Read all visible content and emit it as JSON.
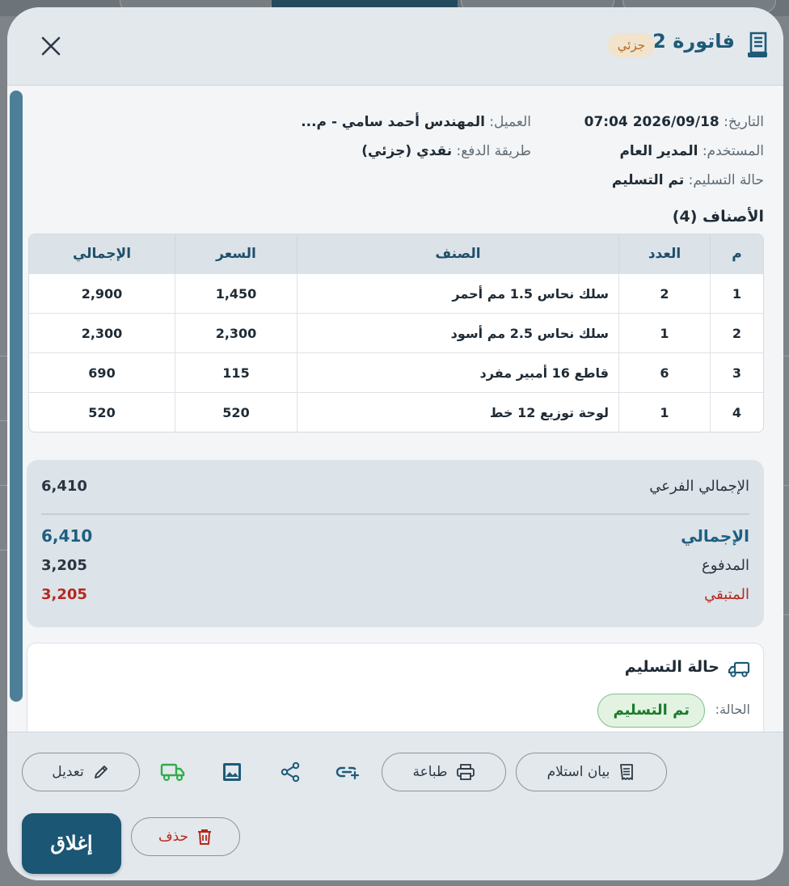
{
  "header": {
    "title": "فاتورة 2",
    "badge": "جزئي"
  },
  "info": {
    "date_label": "التاريخ:",
    "date_value": "2026/09/18 07:04",
    "client_label": "العميل:",
    "client_value": "المهندس أحمد سامي - م...",
    "user_label": "المستخدم:",
    "user_value": "المدير العام",
    "payment_label": "طريقة الدفع:",
    "payment_value": "نقدي (جزئي)",
    "delivery_label": "حالة التسليم:",
    "delivery_value": "تم التسليم"
  },
  "items": {
    "title": "الأصناف (4)",
    "headers": {
      "idx": "م",
      "qty": "العدد",
      "name": "الصنف",
      "price": "السعر",
      "total": "الإجمالي"
    },
    "rows": [
      {
        "idx": "1",
        "qty": "2",
        "name": "سلك نحاس 1.5 مم أحمر",
        "price": "1,450",
        "total": "2,900"
      },
      {
        "idx": "2",
        "qty": "1",
        "name": "سلك نحاس 2.5 مم أسود",
        "price": "2,300",
        "total": "2,300"
      },
      {
        "idx": "3",
        "qty": "6",
        "name": "قاطع 16 أمبير مفرد",
        "price": "115",
        "total": "690"
      },
      {
        "idx": "4",
        "qty": "1",
        "name": "لوحة توزيع 12 خط",
        "price": "520",
        "total": "520"
      }
    ]
  },
  "totals": {
    "subtotal_label": "الإجمالي الفرعي",
    "subtotal_value": "6,410",
    "total_label": "الإجمالي",
    "total_value": "6,410",
    "paid_label": "المدفوع",
    "paid_value": "3,205",
    "remaining_label": "المتبقي",
    "remaining_value": "3,205"
  },
  "delivery": {
    "title": "حالة التسليم",
    "status_label": "الحالة:",
    "status_value": "تم التسليم"
  },
  "footer": {
    "receipt_label": "بيان استلام",
    "print_label": "طباعة",
    "edit_label": "تعديل",
    "delete_label": "حذف",
    "close_label": "إغلاق"
  },
  "colors": {
    "primary": "#1b5674",
    "accent": "#1e5f82",
    "danger": "#b5281e",
    "success": "#1d7a2c",
    "badge_partial": "#b56a1e"
  }
}
